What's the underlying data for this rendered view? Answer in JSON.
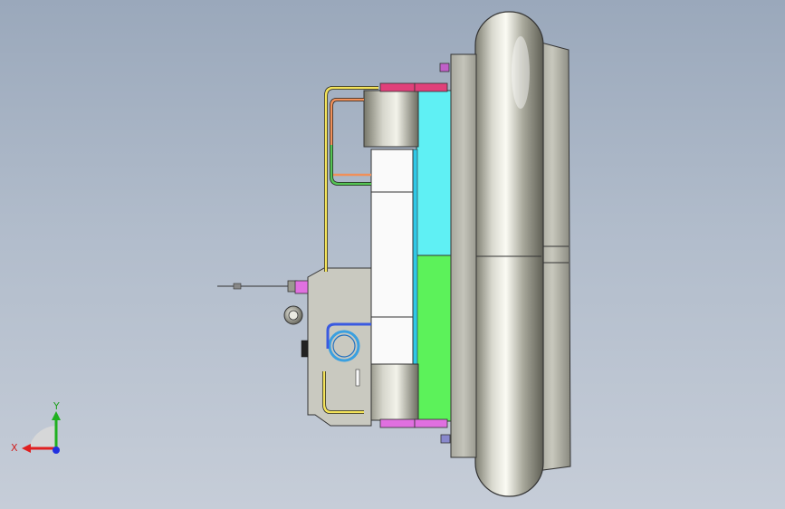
{
  "viewport": {
    "background_top": "#9aa8bb",
    "background_bottom": "#c6cdd8"
  },
  "triad": {
    "x_label": "X",
    "y_label": "Y",
    "x_color": "#e02020",
    "y_color": "#20b020",
    "z_color": "#2030e0"
  },
  "colors": {
    "cyan_plate": "#5ff0f4",
    "green_plate": "#5cf25a",
    "magenta_bolt": "#e070e0",
    "body_gray": "#c9c9c0",
    "yellow_pipe": "#f4e35a",
    "orange_pipe": "#f0905a",
    "green_pipe": "#54c454",
    "blue_pipe": "#3a5ae0"
  }
}
